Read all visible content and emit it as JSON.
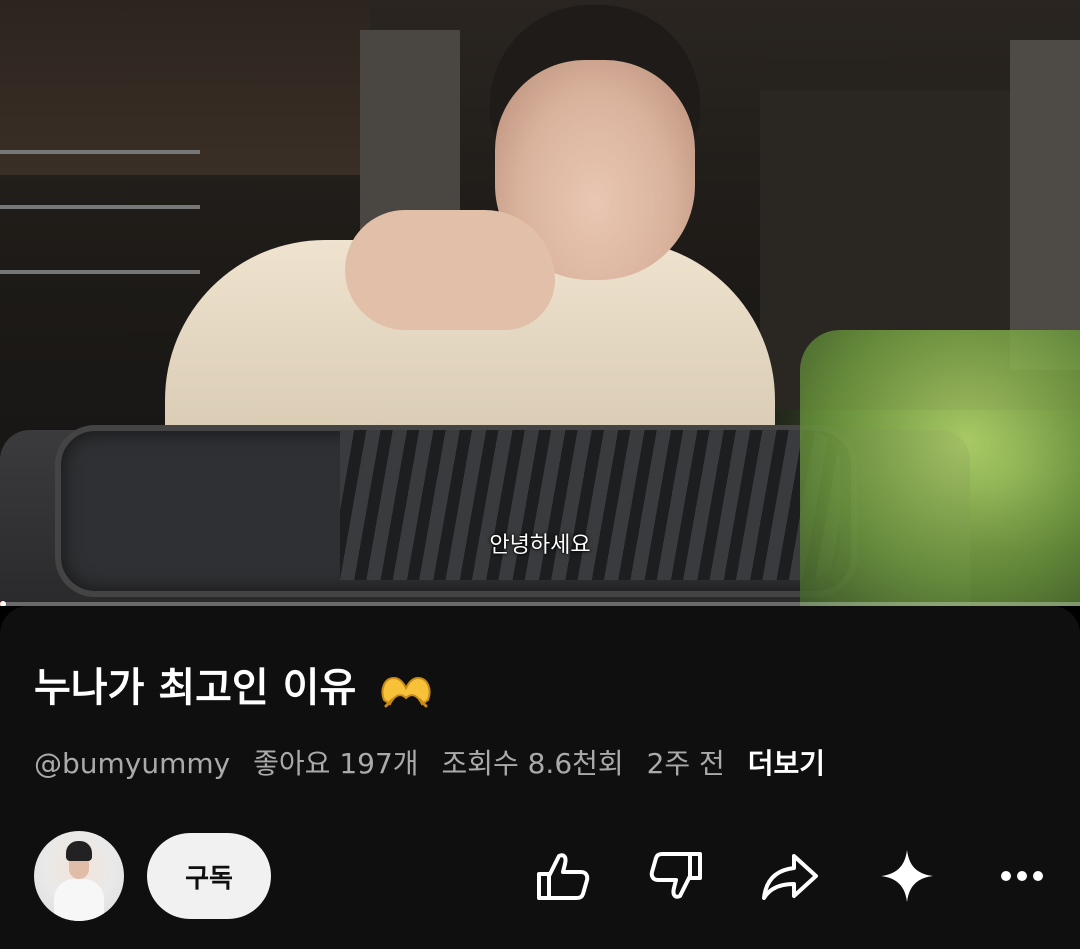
{
  "video": {
    "caption": "안녕하세요",
    "progress_fraction": 0.003
  },
  "info": {
    "title": "누나가 최고인 이유",
    "title_emoji_icon": "heart-hands-emoji-icon",
    "channel_handle": "@bumyummy",
    "likes": "좋아요 197개",
    "views": "조회수 8.6천회",
    "age": "2주 전",
    "more_label": "더보기"
  },
  "actions": {
    "subscribe_label": "구독",
    "icons": [
      "thumbs-up-icon",
      "thumbs-down-icon",
      "share-icon",
      "sparkle-icon",
      "more-icon"
    ]
  },
  "colors": {
    "panel_bg": "#0f0f0f",
    "meta_text": "#aaaaaa",
    "subscribe_bg": "#f1f1f1",
    "progress_played": "#ff0000"
  }
}
